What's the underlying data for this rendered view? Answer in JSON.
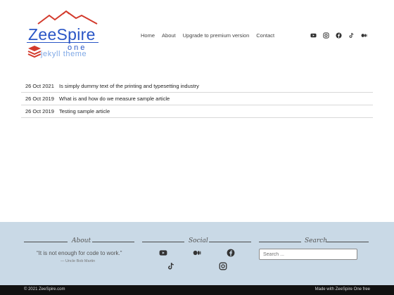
{
  "header": {
    "logo": {
      "name": "ZeeSpire",
      "sub": "one",
      "tag": "jekyll theme"
    },
    "nav": [
      {
        "label": "Home"
      },
      {
        "label": "About"
      },
      {
        "label": "Upgrade to premium version"
      },
      {
        "label": "Contact"
      }
    ],
    "socials": [
      "youtube-icon",
      "instagram-icon",
      "facebook-icon",
      "tiktok-icon",
      "medium-icon"
    ]
  },
  "posts": [
    {
      "date": "26 Oct 2021",
      "title": "Is simply dummy text of the printing and typesetting industry"
    },
    {
      "date": "26 Oct 2019",
      "title": "What is and how do we measure sample article"
    },
    {
      "date": "26 Oct 2019",
      "title": "Testing sample article"
    }
  ],
  "footer": {
    "about": {
      "title": "About",
      "quote": "“It is not enough for code to work.”",
      "author": "— Uncle Bob Martin"
    },
    "social": {
      "title": "Social"
    },
    "search": {
      "title": "Search",
      "placeholder": "Search ..."
    }
  },
  "bottom": {
    "left": "© 2021 ZeeSpire.com",
    "right": "Made with ZeeSpire One free"
  },
  "colors": {
    "brand": "#2a56c6",
    "logo_red": "#d33a2c",
    "footer_bg": "#c9d9e6",
    "bottom_bg": "#111111"
  }
}
